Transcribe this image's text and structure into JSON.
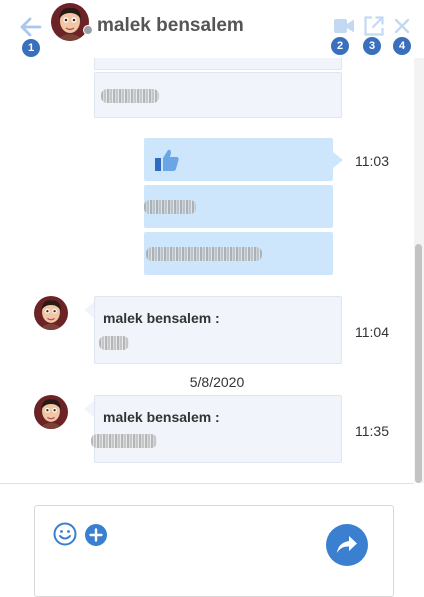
{
  "header": {
    "contact_name": "malek bensalem",
    "presence": "offline",
    "badges": [
      "1",
      "2",
      "3",
      "4"
    ],
    "icons": [
      "back-arrow-icon",
      "video-camera-icon",
      "open-external-icon",
      "close-icon"
    ]
  },
  "messages": [
    {
      "direction": "incoming",
      "content": "blurred"
    },
    {
      "direction": "incoming",
      "content": "blurred"
    },
    {
      "direction": "outgoing",
      "content": "thumbs-up",
      "time": "11:03"
    },
    {
      "direction": "outgoing",
      "content": "blurred"
    },
    {
      "direction": "outgoing",
      "content": "blurred"
    },
    {
      "direction": "incoming",
      "sender": "malek bensalem :",
      "content": "blurred",
      "time": "11:04"
    },
    {
      "direction": "incoming",
      "sender": "malek bensalem :",
      "content": "blurred",
      "time": "11:35"
    }
  ],
  "date_separator": "5/8/2020",
  "composer": {
    "icons": [
      "emoji-icon",
      "add-attachment-icon",
      "send-icon"
    ]
  },
  "colors": {
    "accent": "#3a7fd0",
    "badge": "#3a6fbd",
    "outgoing_bubble": "#cde6fb",
    "incoming_bubble": "#f1f5fb"
  }
}
